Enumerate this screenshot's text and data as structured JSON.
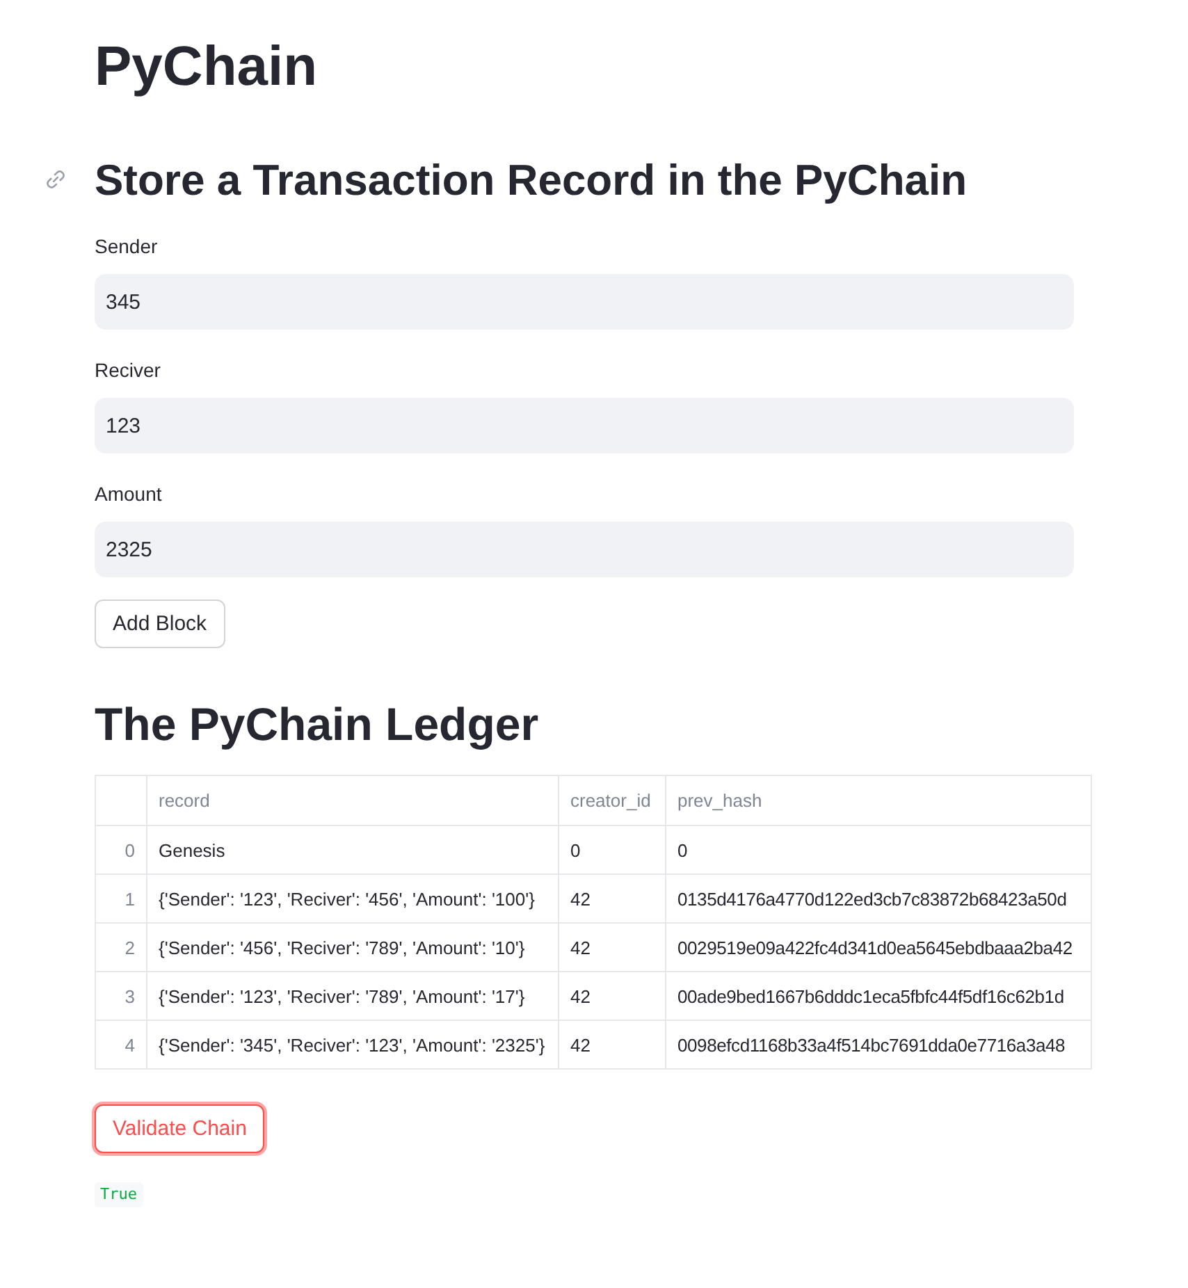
{
  "title": "PyChain",
  "form": {
    "heading": "Store a Transaction Record in the PyChain",
    "fields": [
      {
        "label": "Sender",
        "value": "345"
      },
      {
        "label": "Reciver",
        "value": "123"
      },
      {
        "label": "Amount",
        "value": "2325"
      }
    ],
    "button": {
      "label": "Add Block"
    }
  },
  "ledger": {
    "heading": "The PyChain Ledger",
    "table": {
      "columns": [
        "record",
        "creator_id",
        "prev_hash"
      ],
      "rows": [
        {
          "index": "0",
          "cells": [
            "Genesis",
            "0",
            "0"
          ]
        },
        {
          "index": "1",
          "cells": [
            "{'Sender': '123', 'Reciver': '456', 'Amount': '100'}",
            "42",
            "0135d4176a4770d122ed3cb7c83872b68423a50d"
          ]
        },
        {
          "index": "2",
          "cells": [
            "{'Sender': '456', 'Reciver': '789', 'Amount': '10'}",
            "42",
            "0029519e09a422fc4d341d0ea5645ebdbaaa2ba42"
          ]
        },
        {
          "index": "3",
          "cells": [
            "{'Sender': '123', 'Reciver': '789', 'Amount': '17'}",
            "42",
            "00ade9bed1667b6dddc1eca5fbfc44f5df16c62b1d"
          ]
        },
        {
          "index": "4",
          "cells": [
            "{'Sender': '345', 'Reciver': '123', 'Amount': '2325'}",
            "42",
            "0098efcd1168b33a4f514bc7691dda0e7716a3a48"
          ]
        }
      ]
    }
  },
  "validate_button": {
    "label": "Validate Chain",
    "focused": true
  },
  "result": {
    "text": "True"
  }
}
